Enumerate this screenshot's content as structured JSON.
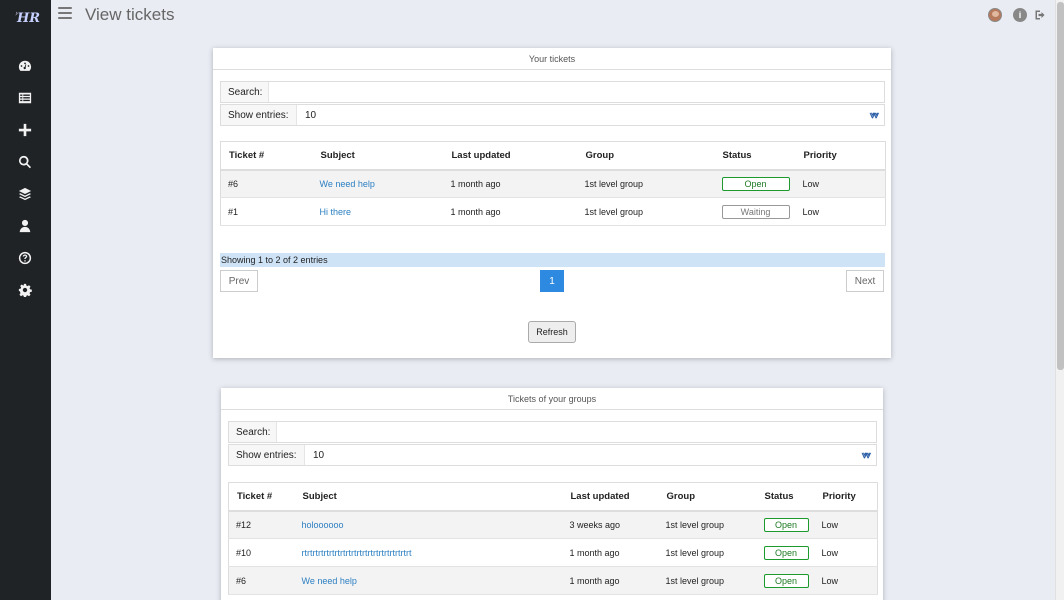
{
  "header": {
    "title": "View tickets",
    "logo": "HR"
  },
  "sidebar": {
    "icons": [
      "dashboard-icon",
      "list-icon",
      "plus-icon",
      "search-icon",
      "layers-icon",
      "user-icon",
      "help-icon",
      "gear-icon"
    ]
  },
  "your_tickets": {
    "title": "Your tickets",
    "search_label": "Search:",
    "entries_label": "Show entries:",
    "entries_value": "10",
    "columns": [
      "Ticket #",
      "Subject",
      "Last updated",
      "Group",
      "Status",
      "Priority"
    ],
    "rows": [
      {
        "ticket": "#6",
        "subject": "We need help",
        "updated": "1 month ago",
        "group": "1st level group",
        "status": "Open",
        "priority": "Low"
      },
      {
        "ticket": "#1",
        "subject": "Hi there",
        "updated": "1 month ago",
        "group": "1st level group",
        "status": "Waiting",
        "priority": "Low"
      }
    ],
    "info": "Showing 1 to 2 of 2 entries",
    "prev": "Prev",
    "next": "Next",
    "page": "1",
    "refresh": "Refresh"
  },
  "group_tickets": {
    "title": "Tickets of your groups",
    "search_label": "Search:",
    "entries_label": "Show entries:",
    "entries_value": "10",
    "columns": [
      "Ticket #",
      "Subject",
      "Last updated",
      "Group",
      "Status",
      "Priority"
    ],
    "rows": [
      {
        "ticket": "#12",
        "subject": "holoooooo",
        "updated": "3 weeks ago",
        "group": "1st level group",
        "status": "Open",
        "priority": "Low"
      },
      {
        "ticket": "#10",
        "subject": "rtrtrtrtrtrtrtrtrtrtrtrtrtrtrtrtrtrtrtrt",
        "updated": "1 month ago",
        "group": "1st level group",
        "status": "Open",
        "priority": "Low"
      },
      {
        "ticket": "#6",
        "subject": "We need help",
        "updated": "1 month ago",
        "group": "1st level group",
        "status": "Open",
        "priority": "Low"
      }
    ]
  },
  "colors": {
    "sidebar": "#1f2326",
    "accent": "#2e8ae0",
    "open": "#1d9a2c",
    "link": "#2c7fc2"
  }
}
